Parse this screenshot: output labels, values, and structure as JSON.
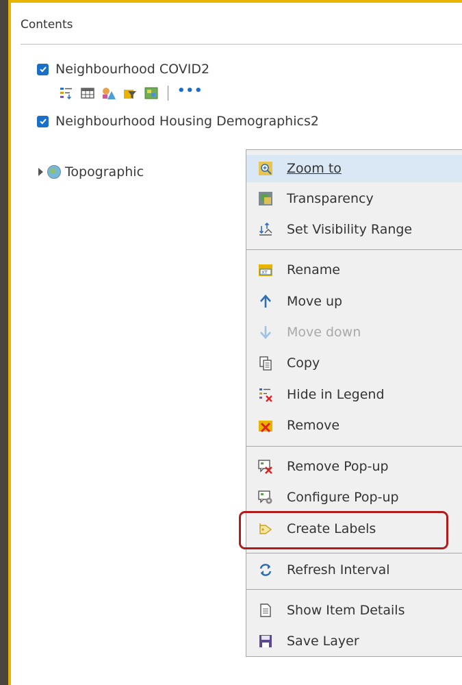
{
  "panel": {
    "title": "Contents"
  },
  "layers": [
    {
      "name": "Neighbourhood COVID2",
      "checked": true
    },
    {
      "name": "Neighbourhood Housing Demographics2",
      "checked": true
    }
  ],
  "layer_toolbar": {
    "icons": [
      "show-legend-icon",
      "show-table-icon",
      "change-style-icon",
      "filter-icon",
      "perform-analysis-icon"
    ],
    "more_label": "•••"
  },
  "basemap": {
    "name": "Topographic"
  },
  "context_menu": {
    "items": [
      {
        "label": "Zoom to",
        "icon": "zoom-to-icon",
        "highlighted": true
      },
      {
        "label": "Transparency",
        "icon": "transparency-icon"
      },
      {
        "label": "Set Visibility Range",
        "icon": "visibility-range-icon"
      },
      {
        "label": "Rename",
        "icon": "rename-icon"
      },
      {
        "label": "Move up",
        "icon": "arrow-up-icon"
      },
      {
        "label": "Move down",
        "icon": "arrow-down-icon",
        "disabled": true
      },
      {
        "label": "Copy",
        "icon": "copy-icon"
      },
      {
        "label": "Hide in Legend",
        "icon": "hide-legend-icon"
      },
      {
        "label": "Remove",
        "icon": "remove-icon"
      },
      {
        "label": "Remove Pop-up",
        "icon": "remove-popup-icon"
      },
      {
        "label": "Configure Pop-up",
        "icon": "configure-popup-icon"
      },
      {
        "label": "Create Labels",
        "icon": "create-labels-icon"
      },
      {
        "label": "Refresh Interval",
        "icon": "refresh-icon"
      },
      {
        "label": "Show Item Details",
        "icon": "item-details-icon"
      },
      {
        "label": "Save Layer",
        "icon": "save-icon"
      }
    ]
  },
  "colors": {
    "accent": "#1a6fc9",
    "frame": "#e8b400",
    "highlight": "#dae8f5",
    "callout": "#b01c1c"
  }
}
